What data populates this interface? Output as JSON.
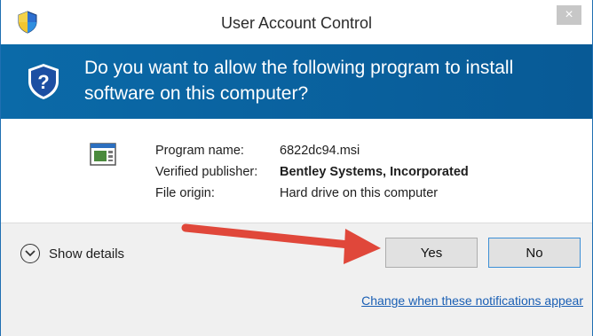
{
  "window": {
    "title": "User Account Control",
    "close_label": "×"
  },
  "banner": {
    "question": "Do you want to allow the following program to install software on this computer?"
  },
  "details": {
    "rows": [
      {
        "label": "Program name:",
        "value": "6822dc94.msi"
      },
      {
        "label": "Verified publisher:",
        "value": "Bentley Systems, Incorporated"
      },
      {
        "label": "File origin:",
        "value": "Hard drive on this computer"
      }
    ]
  },
  "footer": {
    "show_details_label": "Show details",
    "yes_label": "Yes",
    "no_label": "No",
    "notifications_link": "Change when these notifications appear"
  },
  "colors": {
    "banner_blue": "#0b6aa8",
    "arrow_red": "#e0473a",
    "link_blue": "#1a5fb4"
  },
  "icons": {
    "title": "uac-shield-icon",
    "banner": "help-shield-icon",
    "program": "installer-package-icon",
    "toggle": "chevron-down-circle-icon",
    "annotation": "red-arrow-icon"
  }
}
